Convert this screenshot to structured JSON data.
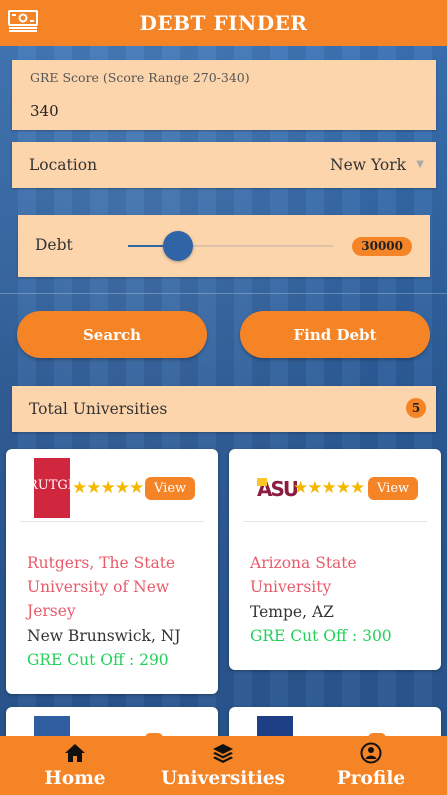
{
  "app": {
    "title": "DEBT FINDER"
  },
  "form": {
    "gre_label": "GRE Score (Score Range 270-340)",
    "gre_value": "340",
    "location_label": "Location",
    "location_value": "New York",
    "debt_label": "Debt",
    "debt_value": "30000",
    "debt_slider_fraction": 0.25
  },
  "actions": {
    "search_label": "Search",
    "find_debt_label": "Find Debt"
  },
  "total": {
    "label": "Total Universities",
    "count": "5"
  },
  "universities": [
    {
      "logo_text": "RUTGERS",
      "stars": "★★★★★",
      "view_label": "View",
      "name": "Rutgers, The State University of New Jersey",
      "city": "New Brunswick, NJ",
      "cutoff": "GRE Cut Off : 290"
    },
    {
      "logo_text": "ASU",
      "stars": "★★★★★",
      "view_label": "View",
      "name": "Arizona State University",
      "city": "Tempe, AZ",
      "cutoff": "GRE Cut Off : 300"
    }
  ],
  "nav": {
    "home": "Home",
    "universities": "Universities",
    "profile": "Profile"
  },
  "colors": {
    "accent": "#f58426",
    "field": "#fdd5ad",
    "primary": "#2f64a6",
    "name": "#e85a6a",
    "cutoff": "#21d05a"
  }
}
